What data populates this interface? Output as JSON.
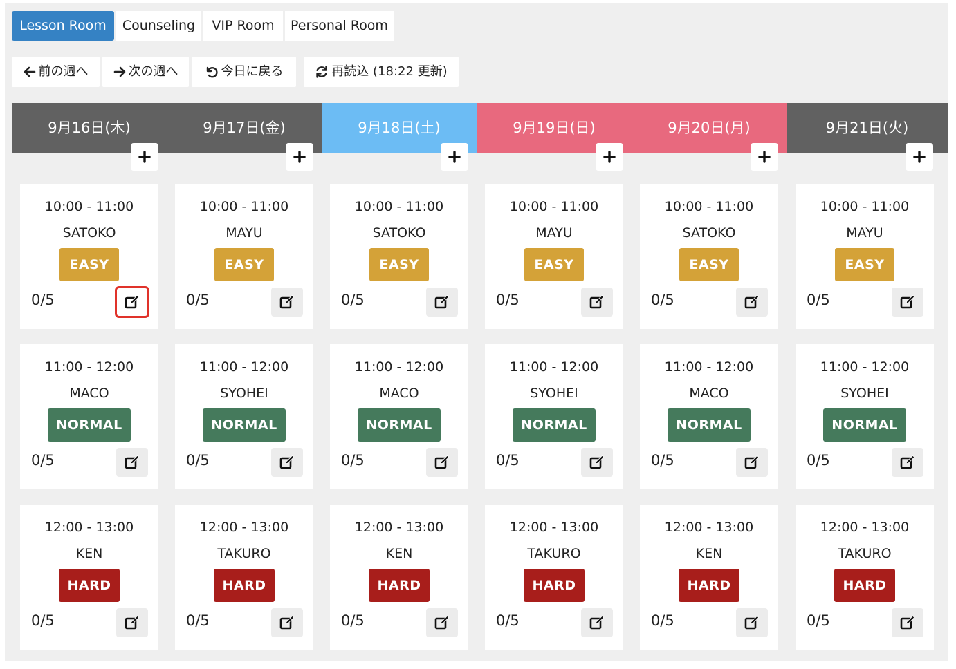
{
  "tabs": [
    "Lesson Room",
    "Counseling",
    "VIP Room",
    "Personal Room"
  ],
  "nav": {
    "prev_week": "前の週へ",
    "next_week": "次の週へ",
    "today": "今日に戻る",
    "reload": "再読込 (18:22 更新)"
  },
  "days": [
    {
      "label": "9月16日(木)",
      "type": "weekday"
    },
    {
      "label": "9月17日(金)",
      "type": "weekday"
    },
    {
      "label": "9月18日(土)",
      "type": "saturday"
    },
    {
      "label": "9月19日(日)",
      "type": "holiday"
    },
    {
      "label": "9月20日(月)",
      "type": "holiday"
    },
    {
      "label": "9月21日(火)",
      "type": "weekday"
    }
  ],
  "slots": [
    {
      "time": "10:00 - 11:00",
      "level": "EASY",
      "level_class": "easy",
      "teachers": [
        "SATOKO",
        "MAYU",
        "SATOKO",
        "MAYU",
        "SATOKO",
        "MAYU"
      ]
    },
    {
      "time": "11:00 - 12:00",
      "level": "NORMAL",
      "level_class": "normal",
      "teachers": [
        "MACO",
        "SYOHEI",
        "MACO",
        "SYOHEI",
        "MACO",
        "SYOHEI"
      ]
    },
    {
      "time": "12:00 - 13:00",
      "level": "HARD",
      "level_class": "hard",
      "teachers": [
        "KEN",
        "TAKURO",
        "KEN",
        "TAKURO",
        "KEN",
        "TAKURO"
      ]
    }
  ],
  "capacity_text": "0/5",
  "colors": {
    "accent": "#3582c4",
    "weekday_header": "#616161",
    "saturday_header": "#6cbcf4",
    "holiday_header": "#e8697e",
    "easy": "#d4a238",
    "normal": "#457a5c",
    "hard": "#a81e1b",
    "highlight": "#e0322a"
  },
  "icons": {
    "prev": "arrow-left-icon",
    "next": "arrow-right-icon",
    "today": "undo-icon",
    "reload": "refresh-icon",
    "add": "plus-icon",
    "edit": "edit-icon"
  },
  "highlighted_edit": {
    "day": 0,
    "slot": 0
  }
}
